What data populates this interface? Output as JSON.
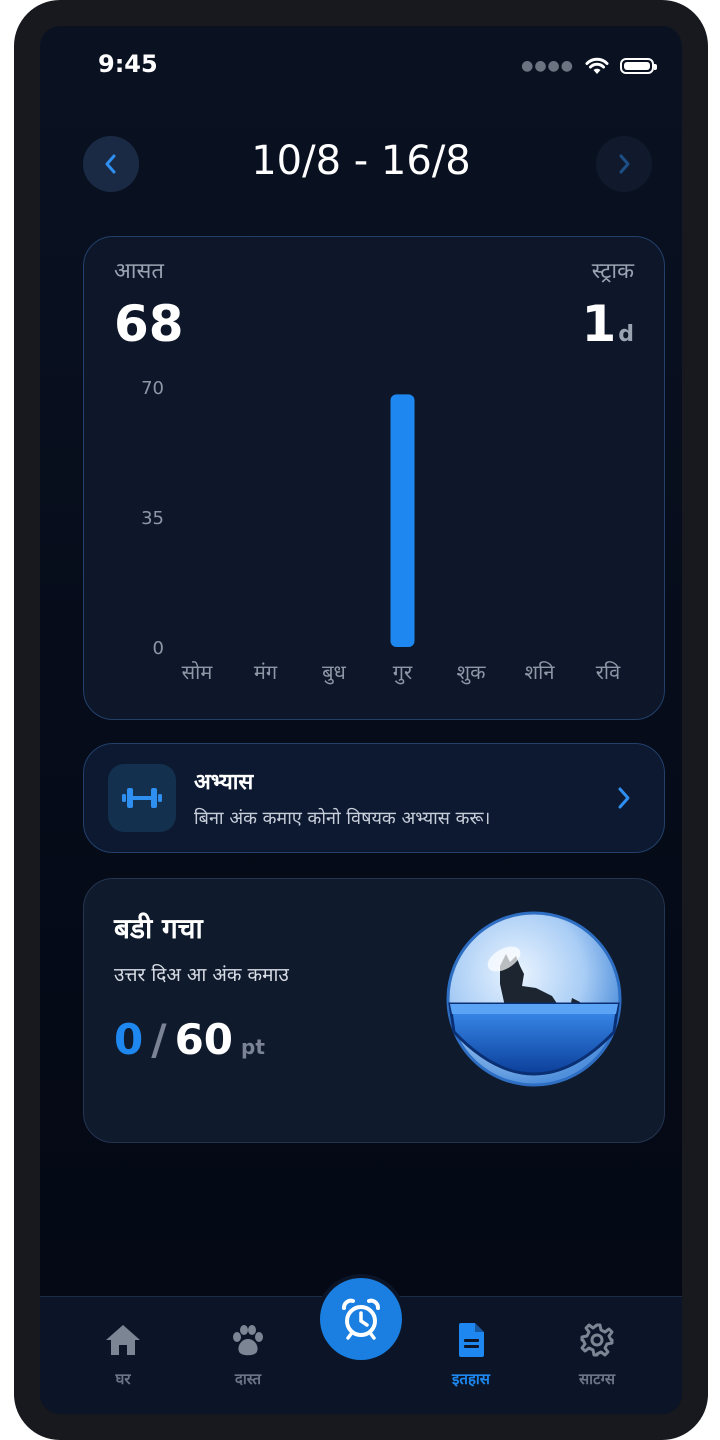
{
  "status": {
    "time": "9:45"
  },
  "header": {
    "week_range": "10/8 - 16/8"
  },
  "stats": {
    "avg_label": "आसत",
    "avg_value": "68",
    "streak_label": "स्ट्राक",
    "streak_value": "1",
    "streak_unit": "d"
  },
  "chart_data": {
    "type": "bar",
    "categories": [
      "सोम",
      "मंग",
      "बुध",
      "गुर",
      "शुक",
      "शनि",
      "रवि"
    ],
    "values": [
      0,
      0,
      0,
      68,
      0,
      0,
      0
    ],
    "y_ticks": [
      "70",
      "35",
      "0"
    ],
    "ylim": [
      0,
      70
    ],
    "bar_color": "#1e88f0"
  },
  "practice": {
    "icon": "dumbbell-icon",
    "title": "अभ्यास",
    "description": "बिना अंक कमाए कोनो विषयक अभ्यास करू।"
  },
  "gacha": {
    "title": "बडी गचा",
    "subtitle": "उत्तर दिअ आ अंक कमाउ",
    "current": "0",
    "slash": "/",
    "total": "60",
    "unit": "pt",
    "image": "dog-capsule"
  },
  "tabs": [
    {
      "label": "घर",
      "icon": "home-icon",
      "active": false
    },
    {
      "label": "दास्त",
      "icon": "paw-icon",
      "active": false
    },
    {
      "label": "इतहास",
      "icon": "document-icon",
      "active": true
    },
    {
      "label": "साटग्स",
      "icon": "gear-icon",
      "active": false
    }
  ],
  "center_action": {
    "icon": "alarm-clock-icon"
  },
  "colors": {
    "accent": "#1e88f0",
    "background": "#060c1a"
  }
}
